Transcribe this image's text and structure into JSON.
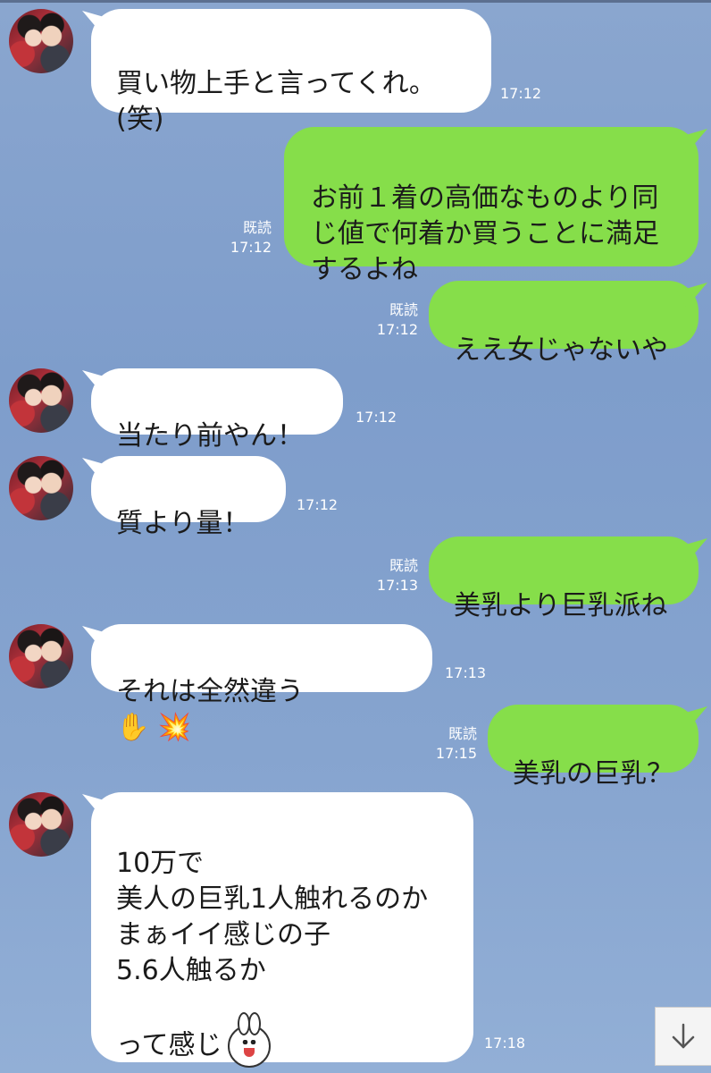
{
  "messages": [
    {
      "from": "friend",
      "text": "買い物上手と言ってくれ。\n(笑)",
      "time": "17:12"
    },
    {
      "from": "me",
      "text": "お前１着の高価なものより同じ値で何着か買うことに満足するよね",
      "read": "既読",
      "time": "17:12"
    },
    {
      "from": "me",
      "text": "ええ女じゃないや",
      "read": "既読",
      "time": "17:12"
    },
    {
      "from": "friend",
      "text": "当たり前やん！",
      "time": "17:12"
    },
    {
      "from": "friend",
      "text": "質より量！",
      "time": "17:12"
    },
    {
      "from": "me",
      "text": "美乳より巨乳派ね",
      "read": "既読",
      "time": "17:13"
    },
    {
      "from": "friend",
      "text": "それは全然違う",
      "emoji": "✋ 💥",
      "time": "17:13"
    },
    {
      "from": "me",
      "text": "美乳の巨乳？",
      "read": "既読",
      "time": "17:15"
    },
    {
      "from": "friend",
      "text": "10万で\n美人の巨乳1人触れるのか\nまぁイイ感じの子\n5.6人触るか\n\nって感じ",
      "time": "17:18"
    }
  ],
  "icons": {
    "avatar": "friend-avatar-photo",
    "scroll": "arrow-down-icon",
    "sticker": "bunny-emoji-icon"
  },
  "colors": {
    "outgoing_bubble": "#86de4a",
    "incoming_bubble": "#ffffff",
    "background": "#86a4cf"
  }
}
